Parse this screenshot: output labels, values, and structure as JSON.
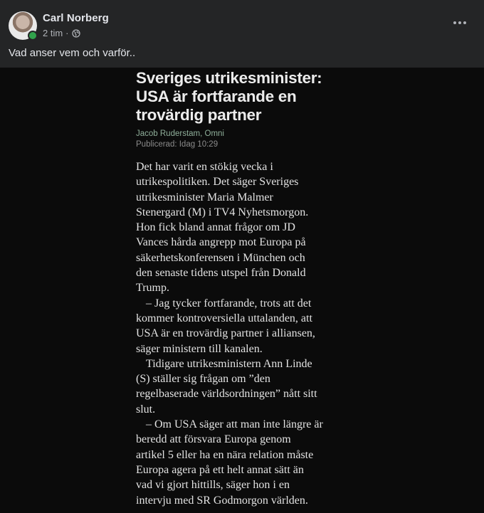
{
  "post": {
    "author": "Carl Norberg",
    "time": "2 tim",
    "separator": "·",
    "privacy_icon": "globe-icon",
    "text": "Vad anser vem och varför.."
  },
  "article": {
    "headline": "Sveriges utrikesminister: USA är fortfarande en trovärdig partner",
    "byline": "Jacob Ruderstam, Omni",
    "published": "Publicerad: Idag 10:29",
    "lines": [
      {
        "text": "Det har varit en stökig vecka i",
        "indent": false
      },
      {
        "text": "utrikespolitiken. Det säger Sveriges",
        "indent": false
      },
      {
        "text": "utrikesminister Maria Malmer",
        "indent": false
      },
      {
        "text": "Stenergard (M) i TV4 Nyhetsmorgon.",
        "indent": false
      },
      {
        "text": "Hon fick bland annat frågor om JD",
        "indent": false
      },
      {
        "text": "Vances hårda angrepp mot Europa på",
        "indent": false
      },
      {
        "text": "säkerhetskonferensen i München och",
        "indent": false
      },
      {
        "text": "den senaste tidens utspel från Donald",
        "indent": false
      },
      {
        "text": "Trump.",
        "indent": false
      },
      {
        "text": "– Jag tycker fortfarande, trots att det",
        "indent": true
      },
      {
        "text": "kommer kontroversiella uttalanden, att",
        "indent": false
      },
      {
        "text": "USA är en trovärdig partner i alliansen,",
        "indent": false
      },
      {
        "text": "säger ministern till kanalen.",
        "indent": false
      },
      {
        "text": "Tidigare utrikesministern Ann Linde",
        "indent": true
      },
      {
        "text": "(S) ställer sig frågan om ”den",
        "indent": false
      },
      {
        "text": "regelbaserade världsordningen” nått sitt",
        "indent": false
      },
      {
        "text": "slut.",
        "indent": false
      },
      {
        "text": "– Om USA säger att man inte längre är",
        "indent": true
      },
      {
        "text": "beredd att försvara Europa genom",
        "indent": false
      },
      {
        "text": "artikel 5 eller ha en nära relation måste",
        "indent": false
      },
      {
        "text": "Europa agera på ett helt annat sätt än",
        "indent": false
      },
      {
        "text": "vad vi gjort hittills, säger hon i en",
        "indent": false
      },
      {
        "text": "intervju med SR Godmorgon världen.",
        "indent": false
      }
    ]
  },
  "colors": {
    "card_bg": "#242526",
    "media_bg": "#0b0b0b",
    "online": "#31a24c",
    "byline": "#8faf9a"
  }
}
